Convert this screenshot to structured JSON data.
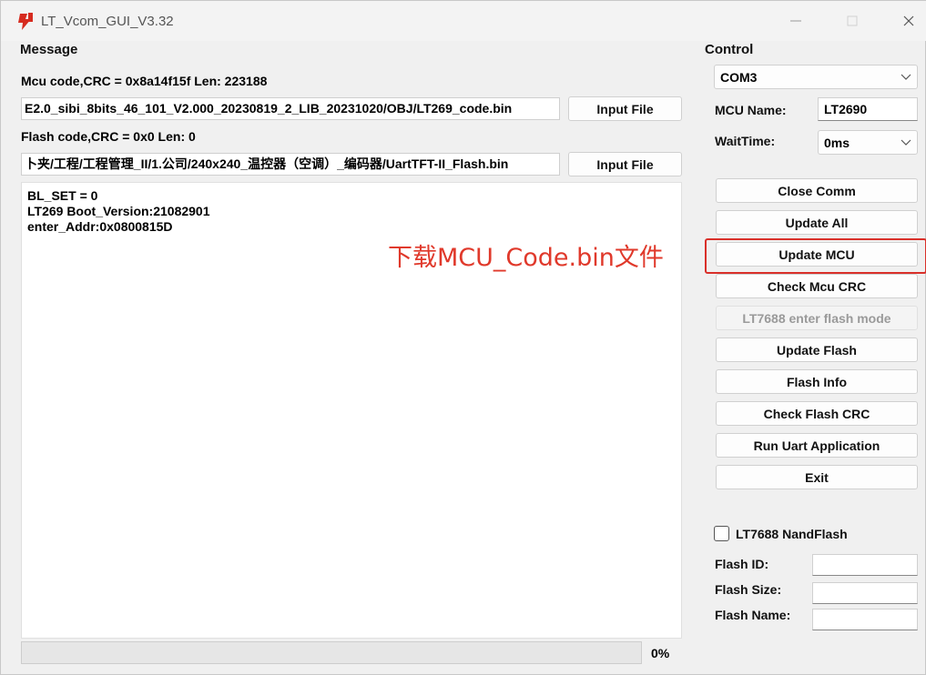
{
  "window": {
    "title": "LT_Vcom_GUI_V3.32",
    "controls": [
      "minimize",
      "maximize",
      "close"
    ]
  },
  "message_group": {
    "label": "Message",
    "mcu_info": "Mcu code,CRC = 0x8a14f15f  Len: 223188",
    "mcu_path": "E2.0_sibi_8bits_46_101_V2.000_20230819_2_LIB_20231020/OBJ/LT269_code.bin",
    "mcu_input_button": "Input File",
    "flash_info": "Flash code,CRC = 0x0  Len: 0",
    "flash_path": "卜夹/工程/工程管理_II/1.公司/240x240_温控器（空调）_编码器/UartTFT-II_Flash.bin",
    "flash_input_button": "Input File",
    "log_lines": [
      "BL_SET = 0",
      "LT269 Boot_Version:21082901",
      "enter_Addr:0x0800815D"
    ],
    "annotation": "下载MCU_Code.bin文件",
    "progress_percent": 0,
    "progress_text": "0%"
  },
  "control_group": {
    "label": "Control",
    "com_port": "COM3",
    "mcu_name_label": "MCU Name:",
    "mcu_name_value": "LT2690",
    "wait_time_label": "WaitTime:",
    "wait_time_value": "0ms",
    "buttons": {
      "close_comm": "Close Comm",
      "update_all": "Update All",
      "update_mcu": "Update MCU",
      "check_mcu_crc": "Check Mcu CRC",
      "lt7688_flash_mode": "LT7688 enter flash mode",
      "update_flash": "Update Flash",
      "flash_info": "Flash Info",
      "check_flash_crc": "Check Flash CRC",
      "run_uart_app": "Run Uart Application",
      "exit": "Exit"
    },
    "nandflash_checkbox_label": "LT7688 NandFlash",
    "nandflash_checked": false,
    "flash_id_label": "Flash ID:",
    "flash_id_value": "",
    "flash_size_label": "Flash Size:",
    "flash_size_value": "",
    "flash_name_label": "Flash Name:",
    "flash_name_value": ""
  },
  "colors": {
    "annotation": "#e0392b",
    "highlight_box": "#d9302a",
    "app_icon": "#d62b1f"
  }
}
